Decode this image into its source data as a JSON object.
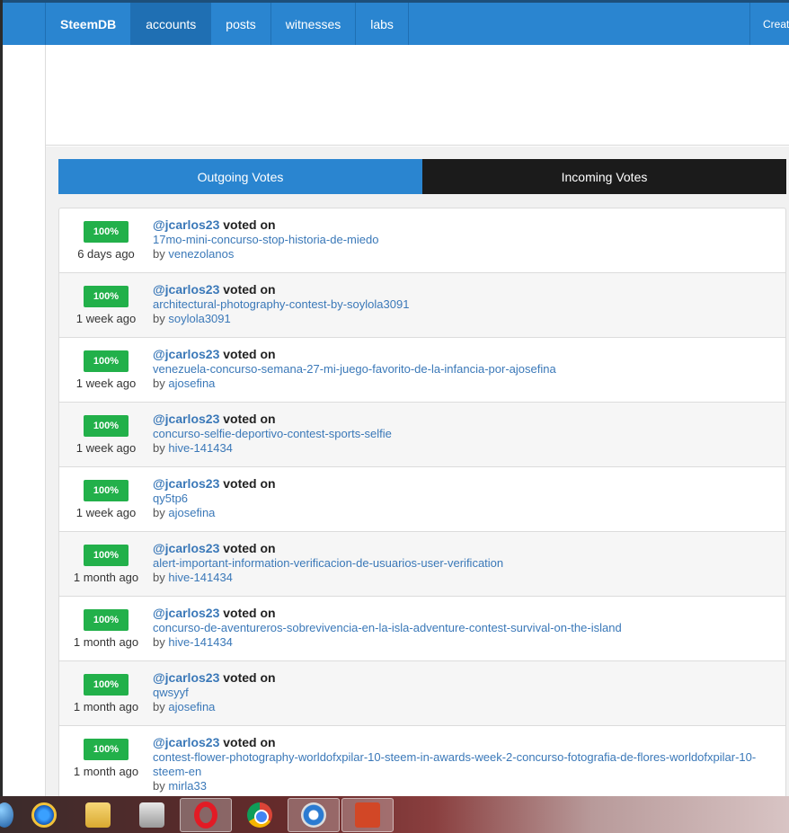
{
  "navbar": {
    "brand": "SteemDB",
    "items": [
      "accounts",
      "posts",
      "witnesses",
      "labs"
    ],
    "active": "accounts",
    "right_label": "Creat"
  },
  "tabs": {
    "outgoing": "Outgoing Votes",
    "incoming": "Incoming Votes"
  },
  "votes": [
    {
      "weight": "100%",
      "time": "6 days ago",
      "voter": "@jcarlos23",
      "action": "voted on",
      "permlink": "17mo-mini-concurso-stop-historia-de-miedo",
      "by": "by",
      "author": "venezolanos"
    },
    {
      "weight": "100%",
      "time": "1 week ago",
      "voter": "@jcarlos23",
      "action": "voted on",
      "permlink": "architectural-photography-contest-by-soylola3091",
      "by": "by",
      "author": "soylola3091"
    },
    {
      "weight": "100%",
      "time": "1 week ago",
      "voter": "@jcarlos23",
      "action": "voted on",
      "permlink": "venezuela-concurso-semana-27-mi-juego-favorito-de-la-infancia-por-ajosefina",
      "by": "by",
      "author": "ajosefina"
    },
    {
      "weight": "100%",
      "time": "1 week ago",
      "voter": "@jcarlos23",
      "action": "voted on",
      "permlink": "concurso-selfie-deportivo-contest-sports-selfie",
      "by": "by",
      "author": "hive-141434"
    },
    {
      "weight": "100%",
      "time": "1 week ago",
      "voter": "@jcarlos23",
      "action": "voted on",
      "permlink": "qy5tp6",
      "by": "by",
      "author": "ajosefina"
    },
    {
      "weight": "100%",
      "time": "1 month ago",
      "voter": "@jcarlos23",
      "action": "voted on",
      "permlink": "alert-important-information-verificacion-de-usuarios-user-verification",
      "by": "by",
      "author": "hive-141434"
    },
    {
      "weight": "100%",
      "time": "1 month ago",
      "voter": "@jcarlos23",
      "action": "voted on",
      "permlink": "concurso-de-aventureros-sobrevivencia-en-la-isla-adventure-contest-survival-on-the-island",
      "by": "by",
      "author": "hive-141434"
    },
    {
      "weight": "100%",
      "time": "1 month ago",
      "voter": "@jcarlos23",
      "action": "voted on",
      "permlink": "qwsyyf",
      "by": "by",
      "author": "ajosefina"
    },
    {
      "weight": "100%",
      "time": "1 month ago",
      "voter": "@jcarlos23",
      "action": "voted on",
      "permlink": "contest-flower-photography-worldofxpilar-10-steem-in-awards-week-2-concurso-fotografia-de-flores-worldofxpilar-10-steem-en",
      "by": "by",
      "author": "mirla33"
    }
  ],
  "taskbar": {
    "icons": [
      "start-orb-icon",
      "internet-explorer-icon",
      "file-explorer-icon",
      "media-player-icon",
      "opera-icon",
      "chrome-icon",
      "network-icon",
      "powerpoint-icon"
    ]
  },
  "colors": {
    "navbar": "#2a85d0",
    "badge": "#22b04a",
    "link": "#3a78b8",
    "incoming_tab": "#1b1b1b"
  }
}
